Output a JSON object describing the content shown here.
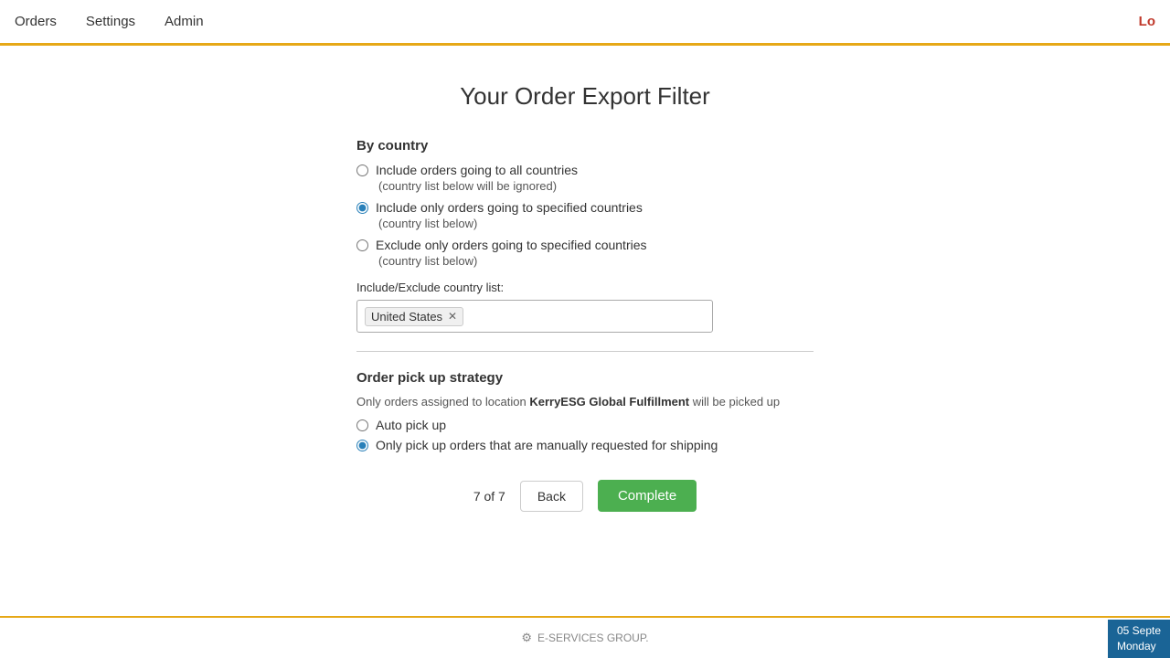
{
  "nav": {
    "items": [
      "Orders",
      "Settings",
      "Admin"
    ],
    "logout_label": "Lo"
  },
  "page": {
    "title": "Your Order Export Filter",
    "by_country": {
      "heading": "By country",
      "options": [
        {
          "label": "Include orders going to all countries",
          "sublabel": "(country list below will be ignored)",
          "value": "all",
          "checked": false
        },
        {
          "label": "Include only orders going to specified countries",
          "sublabel": "(country list below)",
          "value": "include",
          "checked": true
        },
        {
          "label": "Exclude only orders going to specified countries",
          "sublabel": "(country list below)",
          "value": "exclude",
          "checked": false
        }
      ],
      "country_list_label": "Include/Exclude country list:",
      "country_tag": "United States"
    },
    "pickup_strategy": {
      "heading": "Order pick up strategy",
      "description_prefix": "Only orders assigned to location ",
      "location_name": "KerryESG Global Fulfillment",
      "description_suffix": " will be picked up",
      "options": [
        {
          "label": "Auto pick up",
          "value": "auto",
          "checked": false
        },
        {
          "label": "Only pick up orders that are manually requested for shipping",
          "value": "manual",
          "checked": true
        }
      ]
    },
    "navigation": {
      "page_indicator": "7 of 7",
      "back_label": "Back",
      "complete_label": "Complete"
    }
  },
  "footer": {
    "label": "E-SERVICES GROUP."
  },
  "date_widget": {
    "line1": "05 Septe",
    "line2": "Monday"
  }
}
